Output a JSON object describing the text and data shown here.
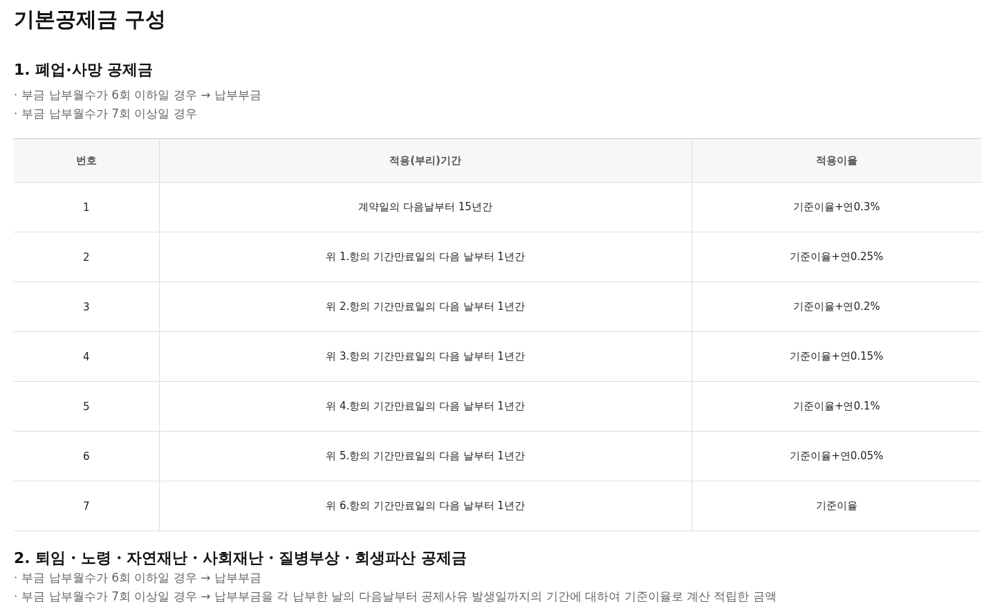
{
  "title": "기본공제금 구성",
  "sections": [
    {
      "heading": "1. 폐업·사망 공제금",
      "bullets": [
        {
          "mark": "·",
          "text": "부금 납부월수가 6회 이하일 경우 → 납부부금"
        },
        {
          "mark": "·",
          "text": "부금 납부월수가 7회 이상일 경우"
        }
      ],
      "table": {
        "columns": [
          "번호",
          "적용(부리)기간",
          "적용이율"
        ],
        "rows": [
          [
            "1",
            "계약일의 다음날부터 15년간",
            "기준이율+연0.3%"
          ],
          [
            "2",
            "위 1.항의 기간만료일의 다음 날부터 1년간",
            "기준이율+연0.25%"
          ],
          [
            "3",
            "위 2.항의 기간만료일의 다음 날부터 1년간",
            "기준이율+연0.2%"
          ],
          [
            "4",
            "위 3.항의 기간만료일의 다음 날부터 1년간",
            "기준이율+연0.15%"
          ],
          [
            "5",
            "위 4.항의 기간만료일의 다음 날부터 1년간",
            "기준이율+연0.1%"
          ],
          [
            "6",
            "위 5.항의 기간만료일의 다음 날부터 1년간",
            "기준이율+연0.05%"
          ],
          [
            "7",
            "위 6.항의 기간만료일의 다음 날부터 1년간",
            "기준이율"
          ]
        ]
      }
    },
    {
      "heading": "2. 퇴임・노령・자연재난・사회재난・질병부상・회생파산 공제금",
      "bullets": [
        {
          "mark": "·",
          "text": "부금 납부월수가 6회 이하일 경우 → 납부부금"
        },
        {
          "mark": "·",
          "text": "부금 납부월수가 7회 이상일 경우 → 납부부금을 각 납부한 날의 다음날부터 공제사유 발생일까지의 기간에 대하여 기준이율로 계산 적립한 금액"
        }
      ]
    }
  ]
}
